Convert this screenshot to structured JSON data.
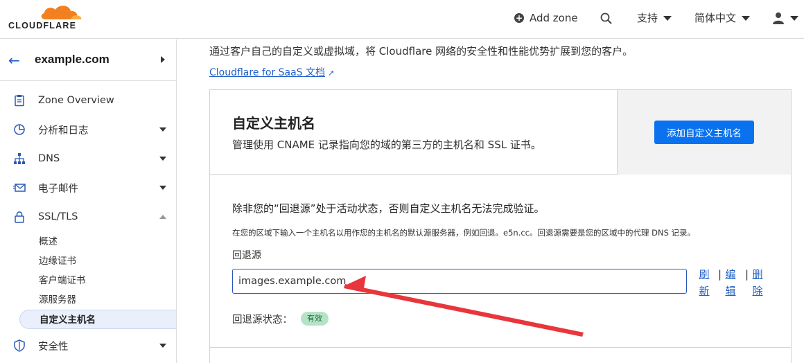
{
  "header": {
    "logo_text": "CLOUDFLARE",
    "add_zone": "Add zone",
    "support": "支持",
    "language": "简体中文"
  },
  "sidebar": {
    "zone": "example.com",
    "items": [
      {
        "label": "Zone Overview",
        "icon": "clipboard-icon"
      },
      {
        "label": "分析和日志",
        "icon": "pie-chart-icon"
      },
      {
        "label": "DNS",
        "icon": "network-icon"
      },
      {
        "label": "电子邮件",
        "icon": "mail-icon"
      },
      {
        "label": "SSL/TLS",
        "icon": "lock-icon"
      }
    ],
    "sub_items": [
      "概述",
      "边缘证书",
      "客户端证书",
      "源服务器",
      "自定义主机名"
    ],
    "security": {
      "label": "安全性",
      "icon": "shield-icon"
    }
  },
  "main": {
    "intro": "通过客户自己的自定义或虚拟域，将 Cloudflare 网络的安全性和性能优势扩展到您的客户。",
    "doc_link": "Cloudflare for SaaS 文档",
    "card": {
      "title": "自定义主机名",
      "description": "管理使用 CNAME 记录指向您的域的第三方的主机名和 SSL 证书。",
      "add_button": "添加自定义主机名",
      "warning": "除非您的“回退源”处于活动状态，否则自定义主机名无法完成验证。",
      "hint": "在您的区域下输入一个主机名以用作您的主机名的默认源服务器，例如回退。e5n.cc。回退源需要是您的区域中的代理 DNS 记录。",
      "field_label": "回退源",
      "field_value": "images.example.com",
      "actions": {
        "refresh": [
          "刷",
          "新"
        ],
        "edit": [
          "编",
          "辑"
        ],
        "delete": [
          "删",
          "除"
        ]
      },
      "status_label": "回退源状态：",
      "status_value": "有效"
    }
  },
  "colors": {
    "accent": "#0a72ef",
    "link": "#1f5fc7",
    "badge": "#b5e3c6",
    "arrow": "#e8363c",
    "logo": "#f38020"
  }
}
